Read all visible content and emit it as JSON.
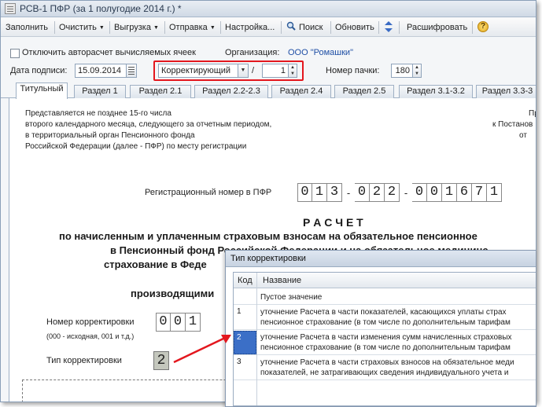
{
  "window": {
    "title": "РСВ-1 ПФР (за 1 полугодие 2014 г.) *"
  },
  "toolbar": {
    "fill": "Заполнить",
    "clear": "Очистить",
    "upload": "Выгрузка",
    "send": "Отправка",
    "settings": "Настройка...",
    "search": "Поиск",
    "refresh": "Обновить",
    "decode": "Расшифровать",
    "help": "?"
  },
  "form": {
    "autocalc_label": "Отключить авторасчет вычисляемых ячеек",
    "org_label": "Организация:",
    "org_value": "ООО \"Ромашки\"",
    "sign_date_label": "Дата подписи:",
    "sign_date_value": "15.09.2014",
    "type_value": "Корректирующий",
    "slash": "/",
    "corr_number": "1",
    "batch_label": "Номер пачки:",
    "batch_value": "180"
  },
  "tabs": [
    "Титульный",
    "Раздел 1",
    "Раздел 2.1",
    "Раздел 2.2-2.3",
    "Раздел 2.4",
    "Раздел 2.5",
    "Раздел 3.1-3.2",
    "Раздел 3.3-3"
  ],
  "doc": {
    "intro": [
      "Представляется не позднее 15-го числа",
      "второго календарного месяца, следующего за отчетным периодом,",
      "в территориальный орган Пенсионного фонда",
      "Российской Федерации (далее - ПФР) по месту регистрации"
    ],
    "right_frag": [
      "Пр",
      "к Постанов",
      "от"
    ],
    "reg_label": "Регистрационный номер в ПФР",
    "reg_number": [
      "0",
      "1",
      "3",
      "-",
      "0",
      "2",
      "2",
      "-",
      "0",
      "0",
      "1",
      "6",
      "7",
      "1"
    ],
    "heading": "Р А С Ч Е Т",
    "sub1": "по начисленным и уплаченным страховым взносам на обязательное пенсионное",
    "sub2": "в Пенсионный фонд Российской Федерации и на обязательное медицинс",
    "sub3": "страхование в Феде",
    "sub4": "производящими",
    "corr_label": "Номер корректировки",
    "corr_digits": [
      "0",
      "0",
      "1"
    ],
    "corr_hint": "(000 - исходная, 001 и т.д.)",
    "type_label": "Тип корректировки",
    "type_value": "2"
  },
  "popup": {
    "title": "Тип корректировки",
    "headers": {
      "code": "Код",
      "name": "Название"
    },
    "rows": [
      {
        "code": "",
        "line1": "Пустое значение",
        "line2": ""
      },
      {
        "code": "1",
        "line1": "уточнение Расчета в части показателей, касающихся  уплаты страх",
        "line2": "пенсионное страхование (в том числе по дополнительным тарифам"
      },
      {
        "code": "2",
        "line1": "уточнение Расчета в части изменения сумм начисленных страховых",
        "line2": "пенсионное страхование (в том числе по дополнительным тарифам"
      },
      {
        "code": "3",
        "line1": "уточнение Расчета в части страховых взносов на обязательное меди",
        "line2": "показателей, не затрагивающих сведения индивидуального учета и"
      }
    ]
  }
}
